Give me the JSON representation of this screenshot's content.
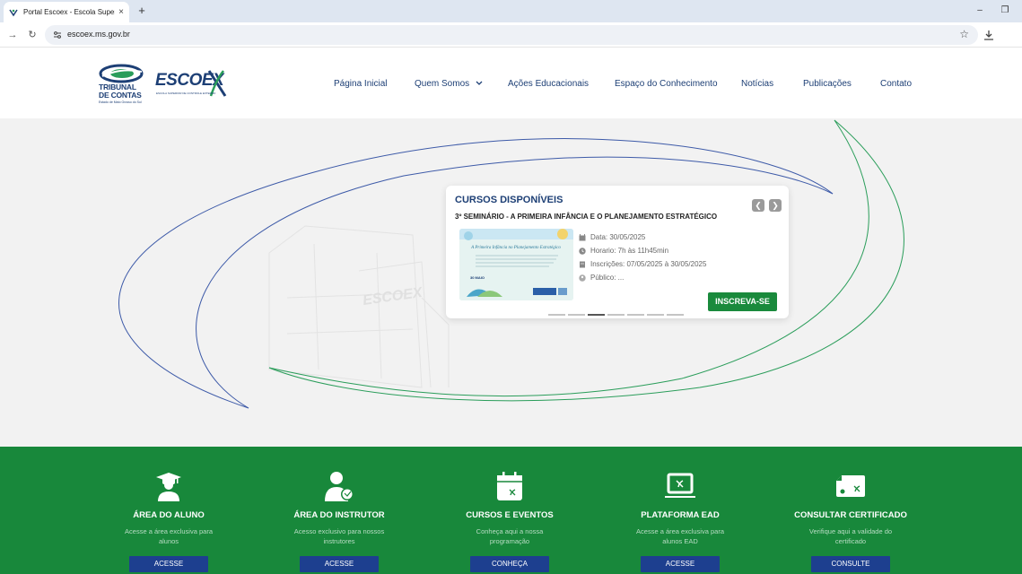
{
  "browser": {
    "tab_title": "Portal Escoex - Escola Superior",
    "url": "escoex.ms.gov.br",
    "new_tab_label": "+"
  },
  "header": {
    "logo_tce_text": "TRIBUNAL DE CONTAS",
    "logo_tce_sub": "Estado de Mato Grosso do Sul",
    "logo_escoex_text": "ESCOEX",
    "logo_escoex_sub": "ESCOLA SUPERIOR DE CONTROLE EXTERNO",
    "nav": [
      {
        "label": "Página Inicial"
      },
      {
        "label": "Quem Somos",
        "has_dropdown": true
      },
      {
        "label": "Ações Educacionais"
      },
      {
        "label": "Espaço do Conhecimento"
      },
      {
        "label": "Notícias"
      },
      {
        "label": "Publicações"
      },
      {
        "label": "Contato"
      }
    ]
  },
  "course_card": {
    "heading": "CURSOS DISPONÍVEIS",
    "title": "3º SEMINÁRIO - A PRIMEIRA INFÂNCIA E O PLANEJAMENTO ESTRATÉGICO",
    "thumb_title": "A Primeira Infância no Planejamento Estratégico",
    "thumb_date": "30 MAIO",
    "date": "Data: 30/05/2025",
    "time": "Horario: 7h às 11h45min",
    "registration": "Inscrições: 07/05/2025 à 30/05/2025",
    "audience": "Público: ...",
    "cta": "INSCREVA-SE",
    "prev_icon": "chevron-left",
    "next_icon": "chevron-right",
    "slide_count": 7,
    "active_slide": 3
  },
  "quick_access": [
    {
      "icon": "graduate-icon",
      "title": "ÁREA DO ALUNO",
      "desc": "Acesse a área exclusiva para alunos",
      "button": "ACESSE"
    },
    {
      "icon": "instructor-icon",
      "title": "ÁREA DO INSTRUTOR",
      "desc": "Acesso exclusivo para nossos instrutores",
      "button": "ACESSE"
    },
    {
      "icon": "calendar-icon",
      "title": "CURSOS E EVENTOS",
      "desc": "Conheça aqui a nossa programação",
      "button": "CONHEÇA"
    },
    {
      "icon": "laptop-icon",
      "title": "PLATAFORMA EAD",
      "desc": "Acesse a área exclusiva para alunos EAD",
      "button": "ACESSE"
    },
    {
      "icon": "certificate-icon",
      "title": "CONSULTAR CERTIFICADO",
      "desc": "Verifique aqui a validade do certificado",
      "button": "CONSULTE"
    }
  ],
  "colors": {
    "brand_navy": "#1d3f75",
    "brand_green": "#18883b",
    "button_green": "#1a8a3c",
    "button_blue": "#1d3f8f"
  }
}
